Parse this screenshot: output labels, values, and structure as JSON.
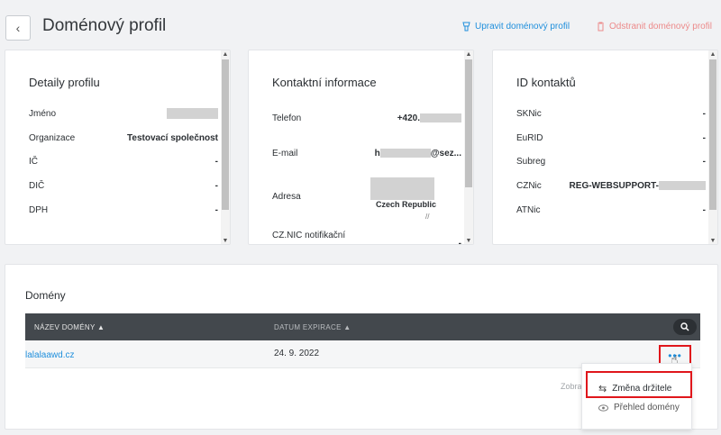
{
  "header": {
    "back_icon": "chevron-left-icon",
    "title": "Doménový profil",
    "edit_label": "Upravit doménový profil",
    "delete_label": "Odstranit doménový profil",
    "edit_color": "#1f8fdc",
    "delete_color": "#ec8a8a"
  },
  "profile_details": {
    "title": "Detaily profilu",
    "rows": [
      {
        "label": "Jméno",
        "value": ""
      },
      {
        "label": "Organizace",
        "value": "Testovací společnost"
      },
      {
        "label": "IČ",
        "value": "-"
      },
      {
        "label": "DIČ",
        "value": "-"
      },
      {
        "label": "DPH",
        "value": "-"
      }
    ]
  },
  "contact_info": {
    "title": "Kontaktní informace",
    "phone_label": "Telefon",
    "phone_value": "+420.",
    "email_label": "E-mail",
    "email_prefix": "h",
    "email_suffix": "@sez...",
    "address_label": "Adresa",
    "address_country": "Czech Republic",
    "notif_label": "CZ.NIC notifikační",
    "notif_value": "-"
  },
  "contact_ids": {
    "title": "ID kontaktů",
    "rows": [
      {
        "label": "SKNic",
        "value": "-"
      },
      {
        "label": "EuRID",
        "value": "-"
      },
      {
        "label": "Subreg",
        "value": "-"
      },
      {
        "label": "CZNic",
        "value": "REG-WEBSUPPORT-"
      },
      {
        "label": "ATNic",
        "value": "-"
      }
    ]
  },
  "domains": {
    "title": "Domény",
    "col_name": "NÁZEV DOMÉNY ▲",
    "col_date": "DATUM EXPIRACE ▲",
    "rows": [
      {
        "name": "lalalaawd.cz",
        "expiry": "24. 9. 2022"
      }
    ],
    "more_label": "•••",
    "show_partial": "Zobra"
  },
  "dropdown": {
    "item1": "Změna držitele",
    "item2": "Přehled domény"
  }
}
